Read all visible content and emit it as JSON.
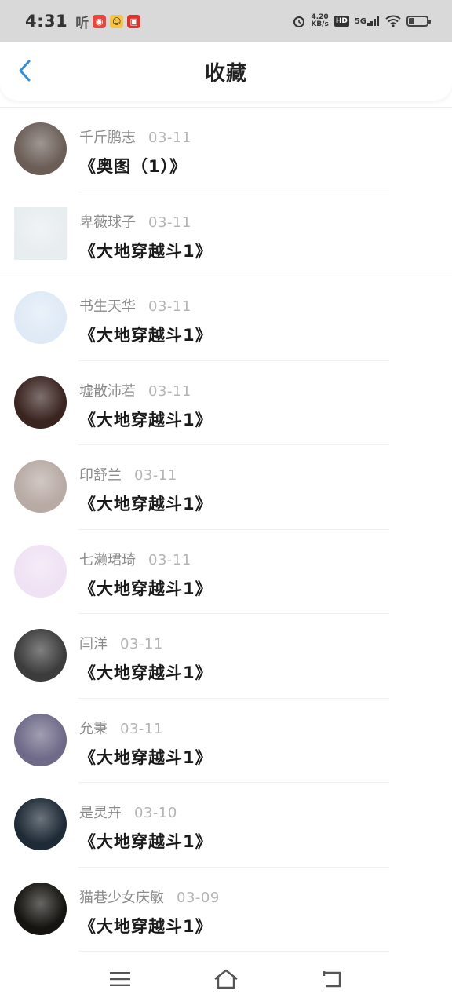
{
  "status_bar": {
    "time": "4:31",
    "notif_ting": "听",
    "speed_value": "4.20",
    "speed_unit": "KB/s",
    "hd": "HD",
    "network": "5G",
    "battery_level": 0.3
  },
  "header": {
    "title": "收藏"
  },
  "favorites": [
    {
      "user": "千斤鹏志",
      "date": "03-11",
      "title": "《奥图（1）》",
      "avatar_color": "#6b5e57"
    },
    {
      "user": "卑薇球子",
      "date": "03-11",
      "title": "《大地穿越斗1》",
      "avatar_color": "#e8edf0"
    },
    {
      "user": "书生天华",
      "date": "03-11",
      "title": "《大地穿越斗1》",
      "avatar_color": "#dfeaf6"
    },
    {
      "user": "墟散沛若",
      "date": "03-11",
      "title": "《大地穿越斗1》",
      "avatar_color": "#3a2420"
    },
    {
      "user": "印舒兰",
      "date": "03-11",
      "title": "《大地穿越斗1》",
      "avatar_color": "#b8aaa4"
    },
    {
      "user": "七濑珺琦",
      "date": "03-11",
      "title": "《大地穿越斗1》",
      "avatar_color": "#efe2f4"
    },
    {
      "user": "闫洋",
      "date": "03-11",
      "title": "《大地穿越斗1》",
      "avatar_color": "#3c3c3c"
    },
    {
      "user": "允秉",
      "date": "03-11",
      "title": "《大地穿越斗1》",
      "avatar_color": "#6e6a88"
    },
    {
      "user": "是灵卉",
      "date": "03-10",
      "title": "《大地穿越斗1》",
      "avatar_color": "#1e2a36"
    },
    {
      "user": "猫巷少女庆敏",
      "date": "03-09",
      "title": "《大地穿越斗1》",
      "avatar_color": "#161410"
    }
  ],
  "colors": {
    "accent": "#2f8fe0",
    "status_bg": "#d9d9d9"
  },
  "icons": {
    "back": "chevron-left-icon",
    "menu": "menu-icon",
    "home": "home-icon",
    "return": "return-icon"
  }
}
